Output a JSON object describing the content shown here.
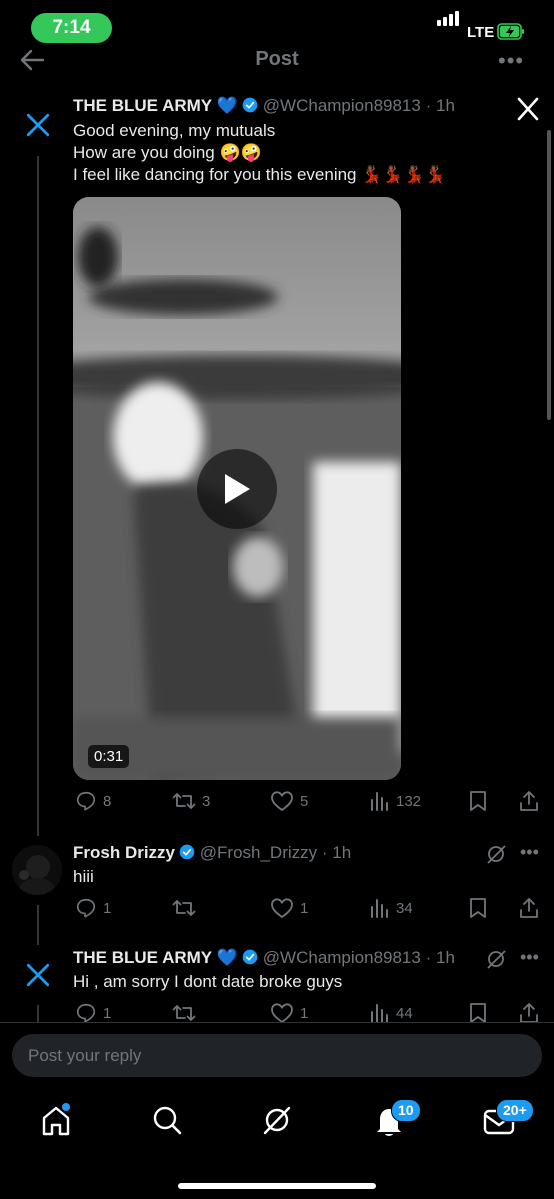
{
  "status_bar": {
    "time": "7:14",
    "network": "LTE"
  },
  "header": {
    "title": "Post",
    "more": "•••"
  },
  "main_post": {
    "name": "THE BLUE ARMY",
    "handle": "@WChampion89813",
    "dot": "·",
    "time": "1h",
    "lines": [
      "Good evening, my mutuals",
      "How are you doing 🤪🤪",
      "I feel like dancing for you this evening 💃🏾💃🏾💃🏾💃🏾"
    ],
    "video": {
      "duration": "0:31"
    },
    "actions": {
      "replies": "8",
      "reposts": "3",
      "likes": "5",
      "views": "132"
    }
  },
  "replies": [
    {
      "name": "Frosh Drizzy",
      "handle": "@Frosh_Drizzy",
      "dot": "·",
      "time": "1h",
      "text": "hiii",
      "actions": {
        "replies": "1",
        "reposts": "",
        "likes": "1",
        "views": "34"
      },
      "more": "•••"
    },
    {
      "name": "THE BLUE ARMY",
      "handle": "@WChampion89813",
      "dot": "·",
      "time": "1h",
      "text": "Hi , am sorry I dont date broke guys",
      "actions": {
        "replies": "1",
        "reposts": "",
        "likes": "1",
        "views": "44"
      },
      "more": "•••"
    }
  ],
  "reply_box": {
    "placeholder": "Post your reply"
  },
  "tabbar": {
    "notifications_badge": "10",
    "messages_badge": "20+"
  },
  "colors": {
    "accent": "#1d9bf0",
    "background": "#000000",
    "status_green": "#34c759",
    "muted": "#71767b"
  },
  "icons": [
    "back-arrow-icon",
    "x-logo-icon",
    "verified-icon",
    "blue-heart-emoji",
    "play-icon",
    "reply-icon",
    "repost-icon",
    "like-icon",
    "views-icon",
    "bookmark-icon",
    "share-icon",
    "grok-icon",
    "home-icon",
    "search-icon",
    "bell-icon",
    "mail-icon"
  ]
}
